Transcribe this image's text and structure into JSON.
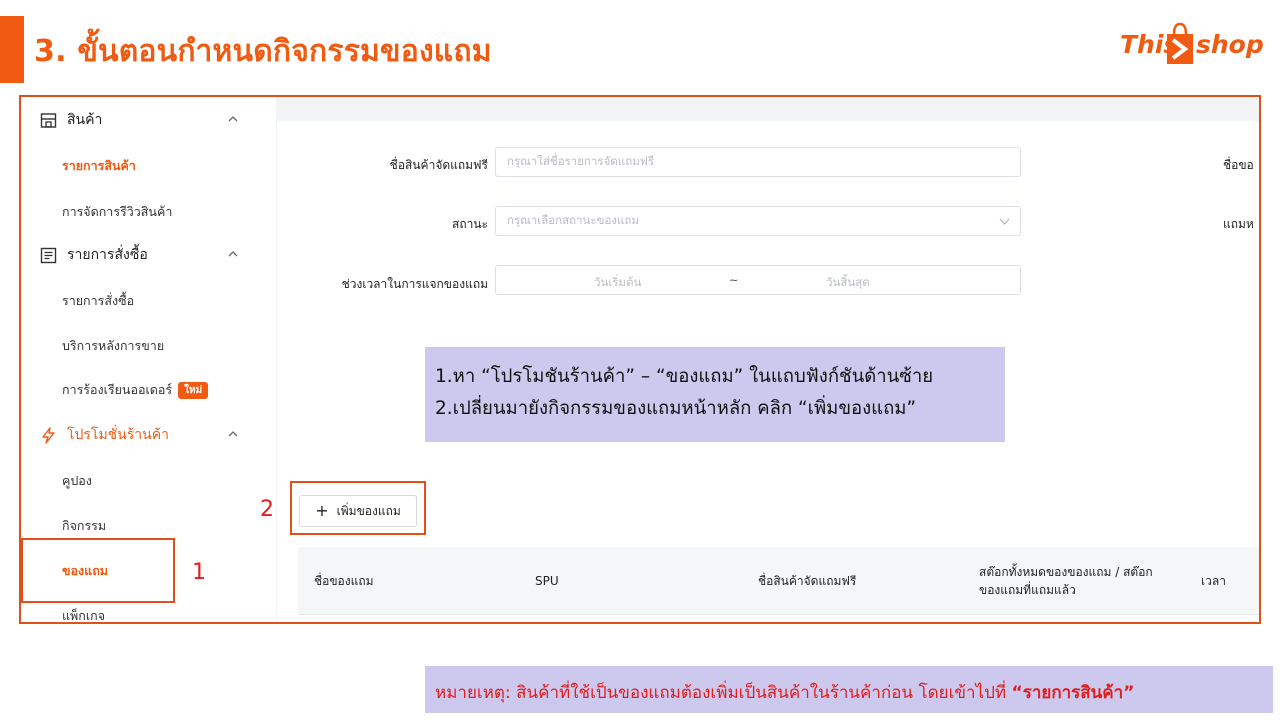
{
  "slide": {
    "title": "3. ขั้นตอนกำหนดกิจกรรมของแถม",
    "accent_color": "#f05a11",
    "logo": {
      "part1": "This",
      "part2": "shop",
      "icon": "shopping-bag-icon"
    }
  },
  "sidebar": {
    "groups": [
      {
        "label": "สินค้า",
        "icon": "store-icon"
      },
      {
        "label": "รายการสั่งซื้อ",
        "icon": "list-icon"
      },
      {
        "label": "โปรโมชั่นร้านค้า",
        "icon": "lightning-icon"
      }
    ],
    "items": [
      {
        "label": "รายการสินค้า"
      },
      {
        "label": "การจัดการรีวิวสินค้า"
      },
      {
        "label": "รายการสั่งซื้อ"
      },
      {
        "label": "บริการหลังการขาย"
      },
      {
        "label": "การร้องเรียนออเดอร์",
        "badge": "ใหม่"
      },
      {
        "label": "คูปอง"
      },
      {
        "label": "กิจกรรม"
      },
      {
        "label": "ของแถม"
      },
      {
        "label": "แพ็กเกจ"
      }
    ]
  },
  "form": {
    "gift_name_label": "ชื่อสินค้าจัดแถมฟรี",
    "gift_name_placeholder": "กรุณาใส่ชื่อรายการจัดแถมฟรี",
    "status_label": "สถานะ",
    "status_placeholder": "กรุณาเลือกสถานะของแถม",
    "period_label": "ช่วงเวลาในการแจกของแถม",
    "start_placeholder": "วันเริ่มต้น",
    "range_sep": "~",
    "end_placeholder": "วันสิ้นสุด",
    "cut_label_1": "ชื่อขอ",
    "cut_label_2": "แถมห"
  },
  "add_button": {
    "label": "เพิ่มของแถม"
  },
  "table": {
    "headers": [
      "ชื่อของแถม",
      "SPU",
      "ชื่อสินค้าจัดแถมฟรี",
      "สต๊อกทั้งหมดของของแถม / สต๊อกของแถมที่แถมแล้ว",
      "เวลา"
    ]
  },
  "annotations": {
    "step1": "1",
    "step2": "2",
    "callout_line1": "1.หา “โปรโมชันร้านค้า” – “ของแถม” ในแถบฟังก์ชันด้านซ้าย",
    "callout_line2": "2.เปลี่ยนมายังกิจกรรมของแถมหน้าหลัก คลิก “เพิ่มของแถม”",
    "note_prefix": "หมายเหตุ: สินค้าที่ใช้เป็นของแถมต้องเพิ่มเป็นสินค้าในร้านค้าก่อน โดยเข้าไปที่ ",
    "note_emphasis": "“รายการสินค้า”"
  }
}
